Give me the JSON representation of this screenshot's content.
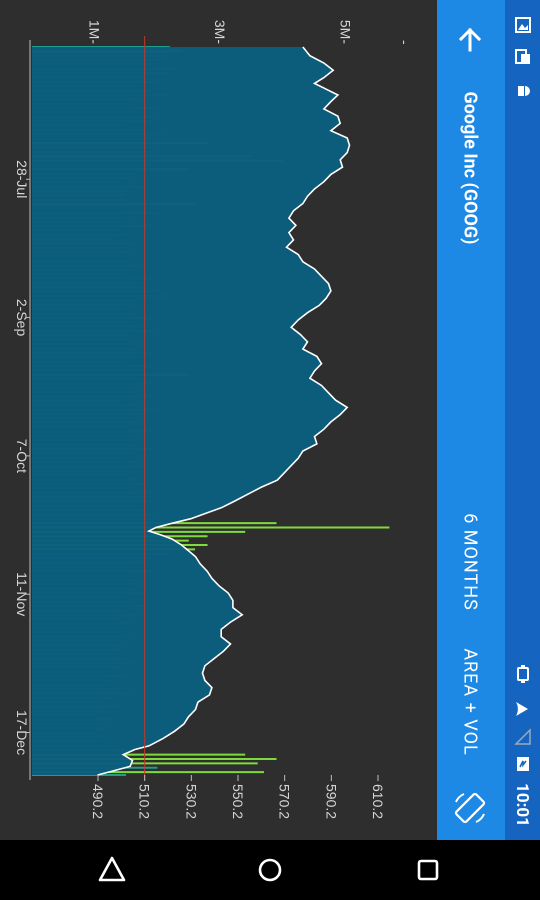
{
  "status_bar": {
    "time": "10:01",
    "icons": [
      "image-icon",
      "screenshot-icon",
      "android-icon",
      "vibrate-icon",
      "wifi-icon",
      "signal-icon",
      "battery-icon"
    ]
  },
  "toolbar": {
    "title": "Google Inc (GOOG)",
    "range": "6 MONTHS",
    "chart_type": "AREA + VOL",
    "back_icon": "arrow-back-icon",
    "rotate_icon": "screen-rotation-icon"
  },
  "navigation": {
    "buttons": [
      "back-triangle-icon",
      "home-circle-icon",
      "recents-square-icon"
    ]
  },
  "colors": {
    "area_fill": "#0b5e7e",
    "price_line": "#ffffff",
    "volume_normal": "#1e9c8c",
    "volume_high": "#7ddc3c",
    "reference_line": "#c0392b",
    "toolbar": "#1e88e5",
    "statusbar": "#1565c0",
    "background": "#2e2e2e"
  },
  "chart_data": {
    "type": "area",
    "title": "",
    "orientation": "rotated-90",
    "x_axis": {
      "type": "date",
      "tick_labels": [
        "28-Jul",
        "2-Sep",
        "7-Oct",
        "11-Nov",
        "17-Dec"
      ],
      "tick_values": [
        0.205,
        0.395,
        0.585,
        0.775,
        0.965
      ]
    },
    "price_axis": {
      "tick_labels": [
        "490.2",
        "510.2",
        "530.2",
        "550.2",
        "570.2",
        "590.2",
        "610.2"
      ],
      "tick_values": [
        490.2,
        510.2,
        530.2,
        550.2,
        570.2,
        590.2,
        610.2
      ],
      "range": [
        480.0,
        620.0
      ]
    },
    "volume_axis": {
      "tick_labels": [
        "1M",
        "3M",
        "5M"
      ],
      "tick_values": [
        1,
        3,
        5
      ],
      "range": [
        0,
        6
      ]
    },
    "reference_value": 510.2,
    "price_series": [
      [
        0.0,
        578
      ],
      [
        0.012,
        581
      ],
      [
        0.022,
        587
      ],
      [
        0.032,
        591
      ],
      [
        0.042,
        587
      ],
      [
        0.05,
        583
      ],
      [
        0.058,
        588
      ],
      [
        0.066,
        593
      ],
      [
        0.075,
        590
      ],
      [
        0.085,
        587
      ],
      [
        0.095,
        593
      ],
      [
        0.105,
        594
      ],
      [
        0.115,
        590
      ],
      [
        0.125,
        597
      ],
      [
        0.135,
        598
      ],
      [
        0.145,
        597
      ],
      [
        0.155,
        594
      ],
      [
        0.165,
        595
      ],
      [
        0.175,
        590
      ],
      [
        0.185,
        587
      ],
      [
        0.195,
        583
      ],
      [
        0.205,
        580
      ],
      [
        0.215,
        578
      ],
      [
        0.225,
        574
      ],
      [
        0.235,
        572
      ],
      [
        0.245,
        575
      ],
      [
        0.255,
        572
      ],
      [
        0.265,
        574
      ],
      [
        0.275,
        571
      ],
      [
        0.285,
        576
      ],
      [
        0.295,
        578
      ],
      [
        0.305,
        583
      ],
      [
        0.315,
        586
      ],
      [
        0.325,
        589
      ],
      [
        0.335,
        590
      ],
      [
        0.345,
        588
      ],
      [
        0.355,
        585
      ],
      [
        0.365,
        580
      ],
      [
        0.375,
        576
      ],
      [
        0.385,
        573
      ],
      [
        0.395,
        577
      ],
      [
        0.405,
        580
      ],
      [
        0.415,
        578
      ],
      [
        0.425,
        584
      ],
      [
        0.435,
        586
      ],
      [
        0.445,
        583
      ],
      [
        0.455,
        581
      ],
      [
        0.465,
        586
      ],
      [
        0.475,
        589
      ],
      [
        0.485,
        592
      ],
      [
        0.495,
        597
      ],
      [
        0.505,
        594
      ],
      [
        0.515,
        590
      ],
      [
        0.525,
        587
      ],
      [
        0.535,
        583
      ],
      [
        0.545,
        584
      ],
      [
        0.555,
        578
      ],
      [
        0.565,
        576
      ],
      [
        0.575,
        573
      ],
      [
        0.585,
        570
      ],
      [
        0.595,
        567
      ],
      [
        0.605,
        560
      ],
      [
        0.615,
        554
      ],
      [
        0.625,
        548
      ],
      [
        0.633,
        543
      ],
      [
        0.641,
        536
      ],
      [
        0.648,
        530
      ],
      [
        0.655,
        521
      ],
      [
        0.66,
        515
      ],
      [
        0.665,
        512
      ],
      [
        0.67,
        517
      ],
      [
        0.676,
        522
      ],
      [
        0.684,
        526
      ],
      [
        0.692,
        529
      ],
      [
        0.7,
        532
      ],
      [
        0.71,
        534
      ],
      [
        0.72,
        537
      ],
      [
        0.73,
        539
      ],
      [
        0.74,
        542
      ],
      [
        0.75,
        546
      ],
      [
        0.76,
        548
      ],
      [
        0.77,
        548
      ],
      [
        0.78,
        552
      ],
      [
        0.79,
        547
      ],
      [
        0.8,
        543
      ],
      [
        0.81,
        543
      ],
      [
        0.82,
        547
      ],
      [
        0.83,
        544
      ],
      [
        0.84,
        540
      ],
      [
        0.85,
        536
      ],
      [
        0.86,
        535
      ],
      [
        0.87,
        536
      ],
      [
        0.88,
        539
      ],
      [
        0.89,
        538
      ],
      [
        0.9,
        533
      ],
      [
        0.91,
        532
      ],
      [
        0.92,
        529
      ],
      [
        0.93,
        527
      ],
      [
        0.94,
        523
      ],
      [
        0.95,
        518
      ],
      [
        0.96,
        512
      ],
      [
        0.965,
        506
      ],
      [
        0.972,
        501
      ],
      [
        0.98,
        505
      ],
      [
        0.988,
        504
      ],
      [
        0.995,
        496
      ],
      [
        1.0,
        490
      ]
    ],
    "volume_series": [
      [
        0.0,
        2.2
      ],
      [
        0.006,
        2.4
      ],
      [
        0.012,
        2.2
      ],
      [
        0.018,
        2.0
      ],
      [
        0.024,
        1.9
      ],
      [
        0.03,
        2.3
      ],
      [
        0.036,
        2.2
      ],
      [
        0.042,
        1.8
      ],
      [
        0.048,
        2.0
      ],
      [
        0.054,
        1.7
      ],
      [
        0.06,
        1.9
      ],
      [
        0.066,
        2.2
      ],
      [
        0.072,
        1.8
      ],
      [
        0.078,
        1.6
      ],
      [
        0.084,
        2.0
      ],
      [
        0.09,
        1.7
      ],
      [
        0.096,
        2.0
      ],
      [
        0.102,
        1.9
      ],
      [
        0.108,
        1.5
      ],
      [
        0.114,
        1.8
      ],
      [
        0.12,
        2.1
      ],
      [
        0.126,
        1.9
      ],
      [
        0.132,
        2.8
      ],
      [
        0.138,
        1.9
      ],
      [
        0.144,
        2.0
      ],
      [
        0.15,
        3.5
      ],
      [
        0.156,
        4.0
      ],
      [
        0.162,
        1.9
      ],
      [
        0.168,
        2.5
      ],
      [
        0.174,
        1.7
      ],
      [
        0.18,
        1.6
      ],
      [
        0.186,
        1.4
      ],
      [
        0.192,
        1.8
      ],
      [
        0.198,
        1.6
      ],
      [
        0.204,
        1.5
      ],
      [
        0.21,
        1.5
      ],
      [
        0.216,
        2.6
      ],
      [
        0.222,
        1.4
      ],
      [
        0.228,
        2.0
      ],
      [
        0.234,
        1.5
      ],
      [
        0.24,
        1.6
      ],
      [
        0.246,
        1.9
      ],
      [
        0.252,
        1.4
      ],
      [
        0.258,
        1.5
      ],
      [
        0.264,
        1.3
      ],
      [
        0.27,
        1.7
      ],
      [
        0.276,
        1.5
      ],
      [
        0.282,
        1.6
      ],
      [
        0.288,
        1.4
      ],
      [
        0.294,
        1.5
      ],
      [
        0.3,
        1.8
      ],
      [
        0.306,
        1.6
      ],
      [
        0.312,
        1.5
      ],
      [
        0.318,
        1.9
      ],
      [
        0.324,
        1.7
      ],
      [
        0.33,
        1.8
      ],
      [
        0.336,
        2.0
      ],
      [
        0.342,
        2.2
      ],
      [
        0.348,
        1.7
      ],
      [
        0.354,
        1.6
      ],
      [
        0.36,
        1.5
      ],
      [
        0.366,
        1.7
      ],
      [
        0.372,
        1.9
      ],
      [
        0.378,
        1.6
      ],
      [
        0.384,
        1.8
      ],
      [
        0.39,
        2.0
      ],
      [
        0.396,
        1.6
      ],
      [
        0.402,
        1.5
      ],
      [
        0.408,
        1.8
      ],
      [
        0.414,
        1.6
      ],
      [
        0.42,
        1.9
      ],
      [
        0.426,
        1.7
      ],
      [
        0.432,
        1.5
      ],
      [
        0.438,
        1.9
      ],
      [
        0.444,
        1.8
      ],
      [
        0.45,
        2.5
      ],
      [
        0.456,
        1.7
      ],
      [
        0.462,
        1.9
      ],
      [
        0.468,
        1.6
      ],
      [
        0.474,
        1.7
      ],
      [
        0.48,
        1.9
      ],
      [
        0.486,
        1.5
      ],
      [
        0.492,
        1.7
      ],
      [
        0.498,
        2.0
      ],
      [
        0.504,
        1.8
      ],
      [
        0.51,
        1.6
      ],
      [
        0.516,
        1.7
      ],
      [
        0.522,
        1.5
      ],
      [
        0.528,
        1.9
      ],
      [
        0.534,
        1.6
      ],
      [
        0.54,
        1.7
      ],
      [
        0.546,
        1.6
      ],
      [
        0.552,
        1.9
      ],
      [
        0.558,
        1.6
      ],
      [
        0.564,
        1.5
      ],
      [
        0.57,
        1.7
      ],
      [
        0.576,
        1.8
      ],
      [
        0.582,
        1.6
      ],
      [
        0.588,
        1.5
      ],
      [
        0.594,
        1.7
      ],
      [
        0.6,
        1.8
      ],
      [
        0.606,
        1.6
      ],
      [
        0.612,
        1.9
      ],
      [
        0.618,
        1.8
      ],
      [
        0.624,
        1.9
      ],
      [
        0.63,
        1.7
      ],
      [
        0.636,
        1.8
      ],
      [
        0.642,
        2.0
      ],
      [
        0.648,
        1.9
      ],
      [
        0.654,
        3.9
      ],
      [
        0.66,
        5.7
      ],
      [
        0.666,
        3.4
      ],
      [
        0.672,
        2.8
      ],
      [
        0.678,
        2.5
      ],
      [
        0.684,
        2.8
      ],
      [
        0.69,
        2.6
      ],
      [
        0.696,
        2.2
      ],
      [
        0.702,
        1.9
      ],
      [
        0.708,
        1.8
      ],
      [
        0.714,
        1.6
      ],
      [
        0.72,
        1.9
      ],
      [
        0.726,
        1.5
      ],
      [
        0.732,
        1.7
      ],
      [
        0.738,
        1.9
      ],
      [
        0.744,
        1.6
      ],
      [
        0.75,
        1.8
      ],
      [
        0.756,
        1.5
      ],
      [
        0.762,
        1.6
      ],
      [
        0.768,
        1.8
      ],
      [
        0.774,
        1.5
      ],
      [
        0.78,
        1.7
      ],
      [
        0.786,
        1.4
      ],
      [
        0.792,
        1.6
      ],
      [
        0.798,
        1.5
      ],
      [
        0.804,
        1.4
      ],
      [
        0.81,
        1.6
      ],
      [
        0.816,
        1.3
      ],
      [
        0.822,
        1.5
      ],
      [
        0.828,
        1.4
      ],
      [
        0.834,
        1.3
      ],
      [
        0.84,
        1.5
      ],
      [
        0.846,
        1.6
      ],
      [
        0.852,
        1.4
      ],
      [
        0.858,
        1.2
      ],
      [
        0.864,
        1.5
      ],
      [
        0.87,
        1.3
      ],
      [
        0.876,
        1.2
      ],
      [
        0.882,
        1.4
      ],
      [
        0.888,
        1.6
      ],
      [
        0.894,
        1.3
      ],
      [
        0.9,
        1.1
      ],
      [
        0.906,
        1.4
      ],
      [
        0.912,
        1.2
      ],
      [
        0.918,
        1.0
      ],
      [
        0.924,
        1.3
      ],
      [
        0.93,
        1.1
      ],
      [
        0.936,
        1.2
      ],
      [
        0.942,
        1.0
      ],
      [
        0.948,
        1.2
      ],
      [
        0.954,
        1.1
      ],
      [
        0.96,
        1.3
      ],
      [
        0.966,
        1.6
      ],
      [
        0.972,
        3.4
      ],
      [
        0.978,
        3.9
      ],
      [
        0.984,
        3.6
      ],
      [
        0.99,
        2.0
      ],
      [
        0.996,
        3.7
      ],
      [
        1.0,
        1.5
      ]
    ],
    "volume_highlight_threshold": 2.4,
    "grid": false,
    "legend": "none"
  }
}
